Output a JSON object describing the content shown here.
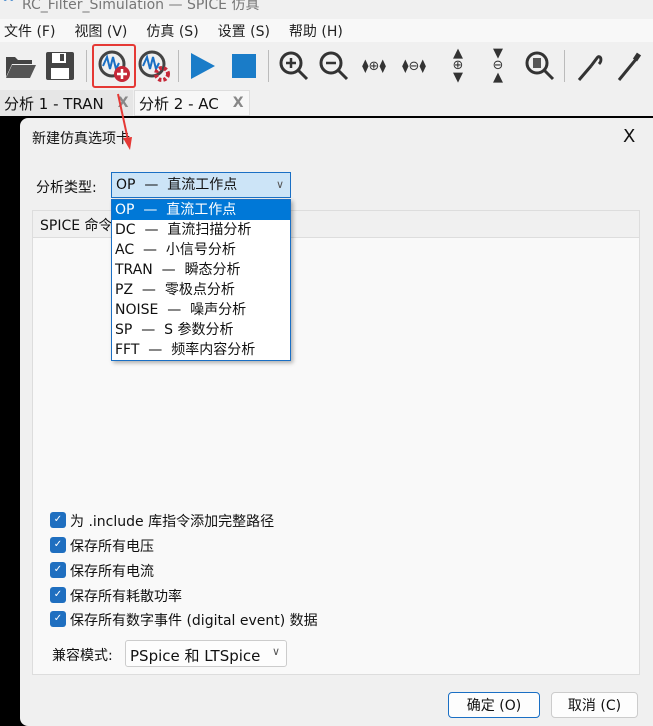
{
  "window": {
    "title": "RC_Filter_Simulation — SPICE 仿真"
  },
  "menu": [
    "文件 (F)",
    "视图 (V)",
    "仿真 (S)",
    "设置 (S)",
    "帮助 (H)"
  ],
  "toolbar": [
    "open-folder-icon",
    "save-icon",
    "new-simulation-tab-icon",
    "simulation-settings-icon",
    "run-icon",
    "stop-icon",
    "zoom-in-icon",
    "zoom-out-icon",
    "zoom-in-horizontal-icon",
    "zoom-out-horizontal-icon",
    "zoom-in-vertical-icon",
    "zoom-out-vertical-icon",
    "zoom-fit-icon",
    "probe-icon",
    "tuner-icon"
  ],
  "tabs": [
    {
      "label": "分析 1 - TRAN",
      "close": "X"
    },
    {
      "label": "分析 2 - AC",
      "close": "X"
    }
  ],
  "dialog": {
    "title": "新建仿真选项卡",
    "close": "X",
    "analysis_label": "分析类型:",
    "analysis_value": "OP  —  直流工作点",
    "options": [
      "OP  —  直流工作点",
      "DC  —  直流扫描分析",
      "AC  —  小信号分析",
      "TRAN  —  瞬态分析",
      "PZ  —  零极点分析",
      "NOISE  —  噪声分析",
      "SP  —  S 参数分析",
      "FFT  —  频率内容分析"
    ],
    "group_tab": "SPICE 命令",
    "checkboxes": [
      {
        "label": "为 .include 库指令添加完整路径",
        "checked": true
      },
      {
        "label": "保存所有电压",
        "checked": true
      },
      {
        "label": "保存所有电流",
        "checked": true
      },
      {
        "label": "保存所有耗散功率",
        "checked": true
      },
      {
        "label": "保存所有数字事件 (digital event) 数据",
        "checked": true
      }
    ],
    "compat_label": "兼容模式:",
    "compat_value": "PSpice 和 LTSpice",
    "ok": "确定 (O)",
    "cancel": "取消 (C)"
  },
  "colors": {
    "accent": "#0078d7",
    "highlight": "#e53935",
    "combo_bg": "#cce4f7"
  }
}
